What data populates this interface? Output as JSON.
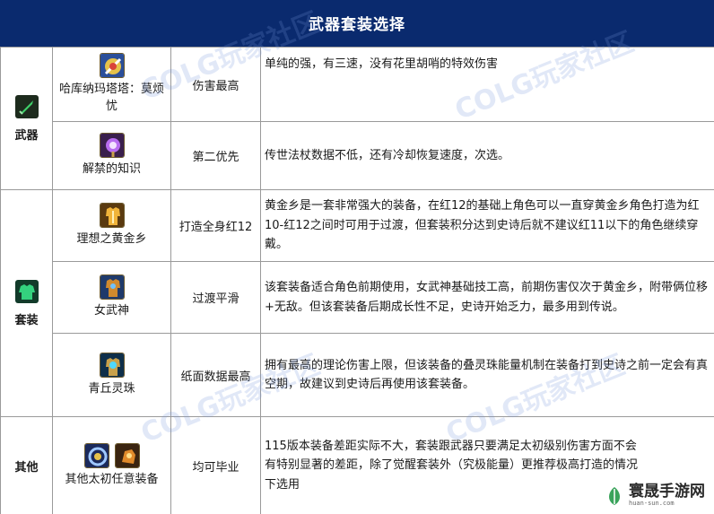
{
  "header": {
    "title": "武器套装选择"
  },
  "sections": [
    {
      "category": "武器",
      "category_icon": "sword-icon",
      "rows": [
        {
          "item": "哈库纳玛塔塔：莫烦忧",
          "icons": [
            "weapon-relic-icon"
          ],
          "rank": "伤害最高",
          "desc": "单纯的强，有三速，没有花里胡哨的特效伤害"
        },
        {
          "item": "解禁的知识",
          "icons": [
            "magic-staff-icon"
          ],
          "rank": "第二优先",
          "desc": "传世法杖数据不低，还有冷却恢复速度，次选。"
        }
      ]
    },
    {
      "category": "套装",
      "category_icon": "armor-icon",
      "rows": [
        {
          "item": "理想之黄金乡",
          "icons": [
            "golden-armor-icon"
          ],
          "rank": "打造全身红12",
          "desc": "黄金乡是一套非常强大的装备，在红12的基础上角色可以一直穿黄金乡角色打造为红10-红12之间时可用于过渡，但套装积分达到史诗后就不建议红11以下的角色继续穿戴。"
        },
        {
          "item": "女武神",
          "icons": [
            "valkyrie-armor-icon"
          ],
          "rank": "过渡平滑",
          "desc": "该套装备适合角色前期使用，女武神基础技工高，前期伤害仅次于黄金乡，附带俩位移+无敌。但该套装备后期成长性不足，史诗开始乏力，最多用到传说。"
        },
        {
          "item": "青丘灵珠",
          "icons": [
            "spirit-orb-icon"
          ],
          "rank": "纸面数据最高",
          "desc": "拥有最高的理论伤害上限，但该装备的叠灵珠能量机制在装备打到史诗之前一定会有真空期，故建议到史诗后再使用该套装备。"
        }
      ]
    },
    {
      "category": "其他",
      "category_icon": "",
      "rows": [
        {
          "item": "其他太初任意装备",
          "icons": [
            "primeval-ring-icon",
            "primeval-gauntlet-icon"
          ],
          "rank": "均可毕业",
          "desc": "115版本装备差距实际不大，套装跟武器只要满足太初级别伤害方面不会有特别显著的差距，除了觉醒套装外（究极能量）更推荐极高打造的情况下选用"
        }
      ]
    }
  ],
  "watermark": {
    "text": "COLG玩家社区"
  },
  "logo": {
    "name": "寰晟手游网",
    "url_text": "huan-sun.com"
  },
  "colors": {
    "header_bg": "#0a2a6e",
    "border": "#9a9a9a"
  }
}
